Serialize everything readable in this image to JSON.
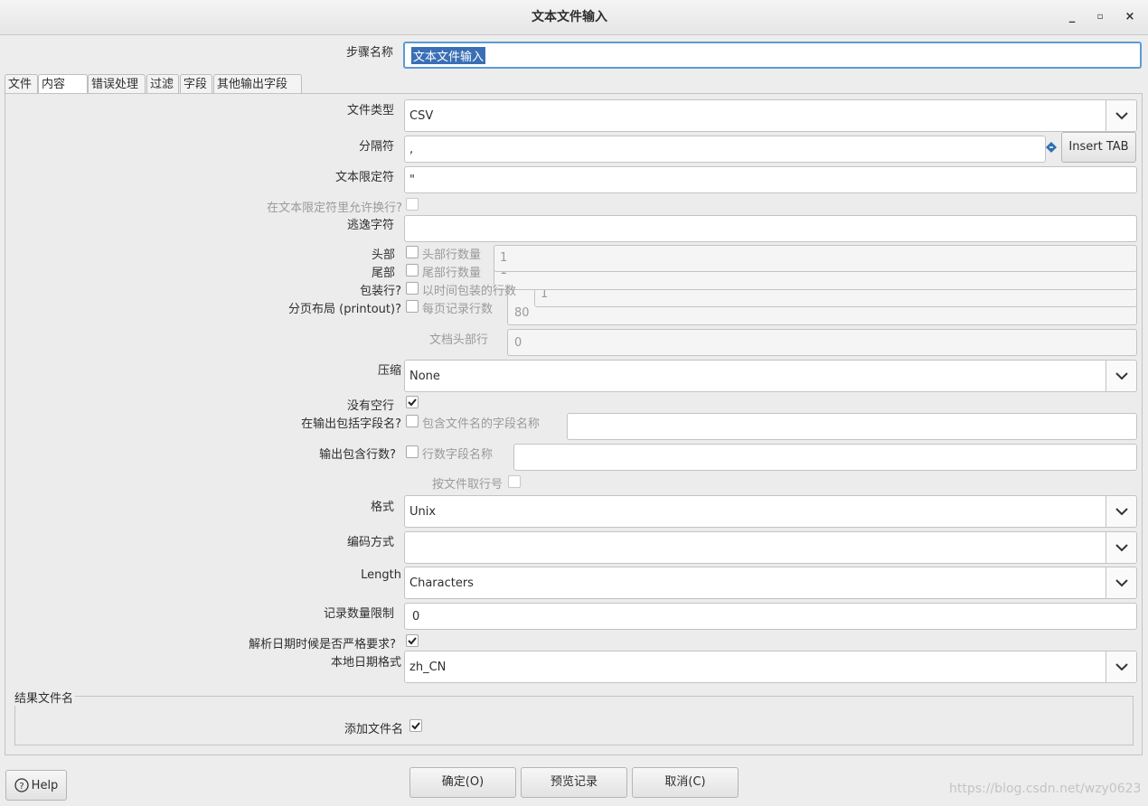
{
  "window": {
    "title": "文本文件输入"
  },
  "step_name": {
    "label": "步骤名称",
    "value": "文本文件输入"
  },
  "tabs": [
    "文件",
    "内容",
    "错误处理",
    "过滤",
    "字段",
    "其他输出字段"
  ],
  "content": {
    "file_type": {
      "label": "文件类型",
      "value": "CSV"
    },
    "separator": {
      "label": "分隔符",
      "value": ",",
      "insert_tab": "Insert TAB"
    },
    "enclosure": {
      "label": "文本限定符",
      "value": "\""
    },
    "break_in_enclosure": {
      "label": "在文本限定符里允许换行?",
      "checked": false
    },
    "escape": {
      "label": "逃逸字符",
      "value": ""
    },
    "header": {
      "label": "头部",
      "checkbox_label": "头部行数量",
      "value": "1",
      "checked": false
    },
    "footer": {
      "label": "尾部",
      "checkbox_label": "尾部行数量",
      "value": "1",
      "checked": false
    },
    "wrap": {
      "label": "包装行?",
      "checkbox_label": "以时间包装的行数",
      "value": "1",
      "checked": false
    },
    "paging": {
      "label": "分页布局 (printout)?",
      "checkbox_label": "每页记录行数",
      "value": "80",
      "checked": false
    },
    "doc_header": {
      "label": "文档头部行",
      "value": "0"
    },
    "compression": {
      "label": "压缩",
      "value": "None"
    },
    "no_empty_rows": {
      "label": "没有空行",
      "checked": true
    },
    "include_filename": {
      "label": "在输出包括字段名?",
      "checkbox_label": "包含文件名的字段名称",
      "value": "",
      "checked": false
    },
    "include_rownum": {
      "label": "输出包含行数?",
      "checkbox_label": "行数字段名称",
      "value": "",
      "checked": false
    },
    "rownum_by_file": {
      "label": "按文件取行号",
      "checked": false
    },
    "format": {
      "label": "格式",
      "value": "Unix"
    },
    "encoding": {
      "label": "编码方式",
      "value": ""
    },
    "length": {
      "label": "Length",
      "value": "Characters"
    },
    "limit": {
      "label": "记录数量限制",
      "value": "0"
    },
    "date_lenient": {
      "label": "解析日期时候是否严格要求?",
      "checked": true
    },
    "locale": {
      "label": "本地日期格式",
      "value": "zh_CN"
    },
    "result_group": {
      "title": "结果文件名",
      "add_filename_label": "添加文件名",
      "checked": true
    }
  },
  "buttons": {
    "help": "Help",
    "ok": "确定(O)",
    "preview": "预览记录",
    "cancel": "取消(C)"
  },
  "watermark": "https://blog.csdn.net/wzy0623"
}
